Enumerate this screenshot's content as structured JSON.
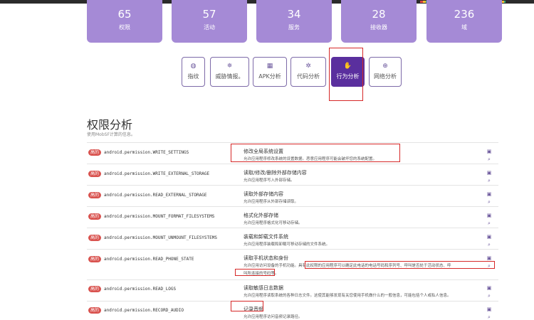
{
  "stats": [
    {
      "value": "65",
      "label": "权限"
    },
    {
      "value": "57",
      "label": "活动"
    },
    {
      "value": "34",
      "label": "服务"
    },
    {
      "value": "28",
      "label": "接收器"
    },
    {
      "value": "236",
      "label": "域"
    }
  ],
  "tabs": [
    {
      "label": "指纹",
      "icon": "fingerprint-icon",
      "glyph": "◍"
    },
    {
      "label": "威胁情报。",
      "icon": "virus-icon",
      "glyph": "✵"
    },
    {
      "label": "APK分析",
      "icon": "archive-icon",
      "glyph": "▦"
    },
    {
      "label": "代码分析",
      "icon": "bug-icon",
      "glyph": "✲"
    },
    {
      "label": "行为分析",
      "icon": "hand-icon",
      "glyph": "✋"
    },
    {
      "label": "网络分析",
      "icon": "globe-icon",
      "glyph": "⊕"
    }
  ],
  "section": {
    "title": "权限分析",
    "subtitle": "使用MobSF计算的信息。"
  },
  "permissions": [
    {
      "badge": "高的",
      "name": "android.permission.WRITE_SETTINGS",
      "title": "修改全局系统设置",
      "desc": "允许应用程序修改系统的设置数据。恶意应用程序可能会破坏您的系统配置。",
      "desc2": ""
    },
    {
      "badge": "高的",
      "name": "android.permission.WRITE_EXTERNAL_STORAGE",
      "title": "读取/修改/删除外部存储内容",
      "desc": "允许应用程序写入外部存储。",
      "desc2": ""
    },
    {
      "badge": "高的",
      "name": "android.permission.READ_EXTERNAL_STORAGE",
      "title": "读取外部存储内容",
      "desc": "允许应用程序从外部存储读取。",
      "desc2": ""
    },
    {
      "badge": "高的",
      "name": "android.permission.MOUNT_FORMAT_FILESYSTEMS",
      "title": "格式化外部存储",
      "desc": "允许应用程序格式化可移动存储。",
      "desc2": ""
    },
    {
      "badge": "高的",
      "name": "android.permission.MOUNT_UNMOUNT_FILESYSTEMS",
      "title": "装载和卸载文件系统",
      "desc": "允许应用程序装载和卸载可移动存储的文件系统。",
      "desc2": ""
    },
    {
      "badge": "高的",
      "name": "android.permission.READ_PHONE_STATE",
      "title": "读取手机状态和身份",
      "desc": "允许应用访问设备的手机功能。具有此权限的应用程序可以确定此电话的电话号码和序列号、呼叫是否处于活动状态、呼",
      "desc2": "叫所连接的号码等。"
    },
    {
      "badge": "高的",
      "name": "android.permission.READ_LOGS",
      "title": "读取敏感日志数据",
      "desc": "允许应用程序读取系统的各种日志文件。这使其能够发现有关您使用手机做什么的一般信息，可能包括个人或私人信息。",
      "desc2": ""
    },
    {
      "badge": "高的",
      "name": "android.permission.RECORD_AUDIO",
      "title": "记录音频",
      "desc": "允许应用程序访问音频记录路径。",
      "desc2": ""
    }
  ],
  "row_actions": {
    "detail_icon": "calendar-icon",
    "search_icon": "search-icon",
    "detail_glyph": "▣",
    "search_glyph": "⌕"
  }
}
